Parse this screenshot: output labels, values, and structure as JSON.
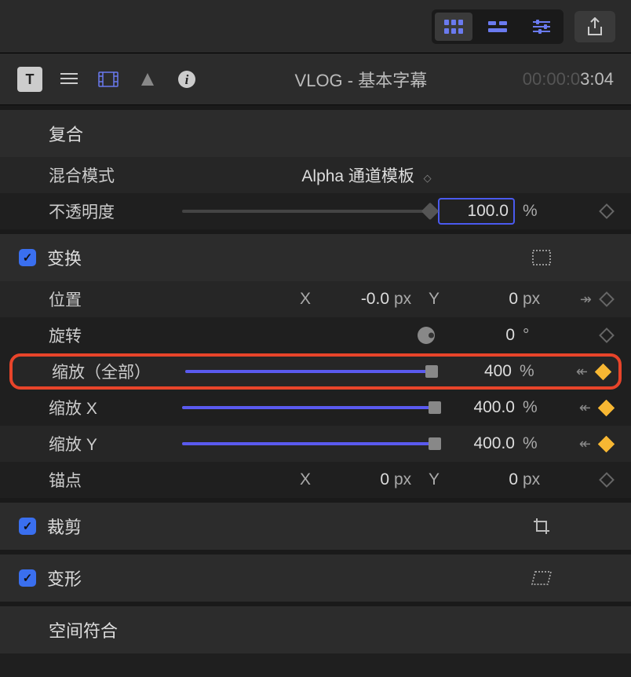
{
  "header": {
    "title": "VLOG - 基本字幕",
    "timecode_prefix": "00:00:0",
    "duration": "3:04"
  },
  "sections": {
    "composite": {
      "title": "复合",
      "blend_mode_label": "混合模式",
      "blend_mode_value": "Alpha 通道模板",
      "opacity_label": "不透明度",
      "opacity_value": "100.0",
      "opacity_unit": "%"
    },
    "transform": {
      "title": "变换",
      "position_label": "位置",
      "position_x": "-0.0",
      "position_y": "0",
      "px": "px",
      "rotation_label": "旋转",
      "rotation_value": "0",
      "rotation_unit": "°",
      "scale_all_label": "缩放（全部）",
      "scale_all_value": "400",
      "scale_x_label": "缩放 X",
      "scale_x_value": "400.0",
      "scale_y_label": "缩放 Y",
      "scale_y_value": "400.0",
      "percent": "%",
      "anchor_label": "锚点",
      "anchor_x": "0",
      "anchor_y": "0"
    },
    "crop": {
      "title": "裁剪"
    },
    "distort": {
      "title": "变形"
    },
    "spatial": {
      "title": "空间符合"
    }
  },
  "labels": {
    "X": "X",
    "Y": "Y"
  }
}
